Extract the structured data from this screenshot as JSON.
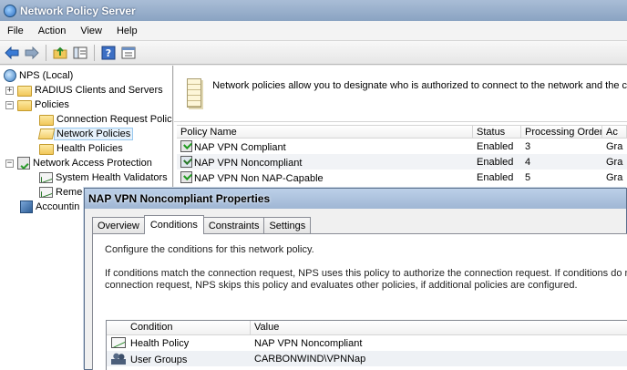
{
  "window": {
    "title": "Network Policy Server"
  },
  "menu": [
    "File",
    "Action",
    "View",
    "Help"
  ],
  "toolbar": [
    "back-icon",
    "forward-icon",
    "up-folder-icon",
    "show-hide-tree-icon",
    "help-icon",
    "properties-icon"
  ],
  "tree": {
    "root": "NPS (Local)",
    "radius": "RADIUS Clients and Servers",
    "policies": "Policies",
    "conn_req": "Connection Request Polici",
    "network_policies": "Network Policies",
    "health_policies": "Health Policies",
    "nap": "Network Access Protection",
    "shv": "System Health Validators",
    "remediation": "Remed",
    "accounting": "Accountin"
  },
  "info": {
    "text": "Network policies allow you to designate who is authorized to connect to the network and the c"
  },
  "grid": {
    "columns": [
      "Policy Name",
      "Status",
      "Processing Order",
      "Ac"
    ],
    "rows": [
      {
        "name": "NAP VPN Compliant",
        "status": "Enabled",
        "order": "3",
        "access": "Gra"
      },
      {
        "name": "NAP VPN Noncompliant",
        "status": "Enabled",
        "order": "4",
        "access": "Gra"
      },
      {
        "name": "NAP VPN Non NAP-Capable",
        "status": "Enabled",
        "order": "5",
        "access": "Gra"
      }
    ]
  },
  "dialog": {
    "title": "NAP VPN Noncompliant Properties",
    "tabs": [
      "Overview",
      "Conditions",
      "Constraints",
      "Settings"
    ],
    "active_tab": "Conditions",
    "intro": "Configure the conditions for this network policy.",
    "para1": "If conditions match the connection request, NPS uses this policy to authorize the connection request. If conditions do not m",
    "para2": "connection request, NPS skips this policy and evaluates other policies, if additional policies are configured.",
    "cond_columns": [
      "Condition",
      "Value"
    ],
    "conditions": [
      {
        "condition": "Health Policy",
        "value": "NAP VPN Noncompliant",
        "icon": "health-policy-icon"
      },
      {
        "condition": "User Groups",
        "value": "CARBONWIND\\VPNNap",
        "icon": "user-groups-icon"
      }
    ]
  }
}
